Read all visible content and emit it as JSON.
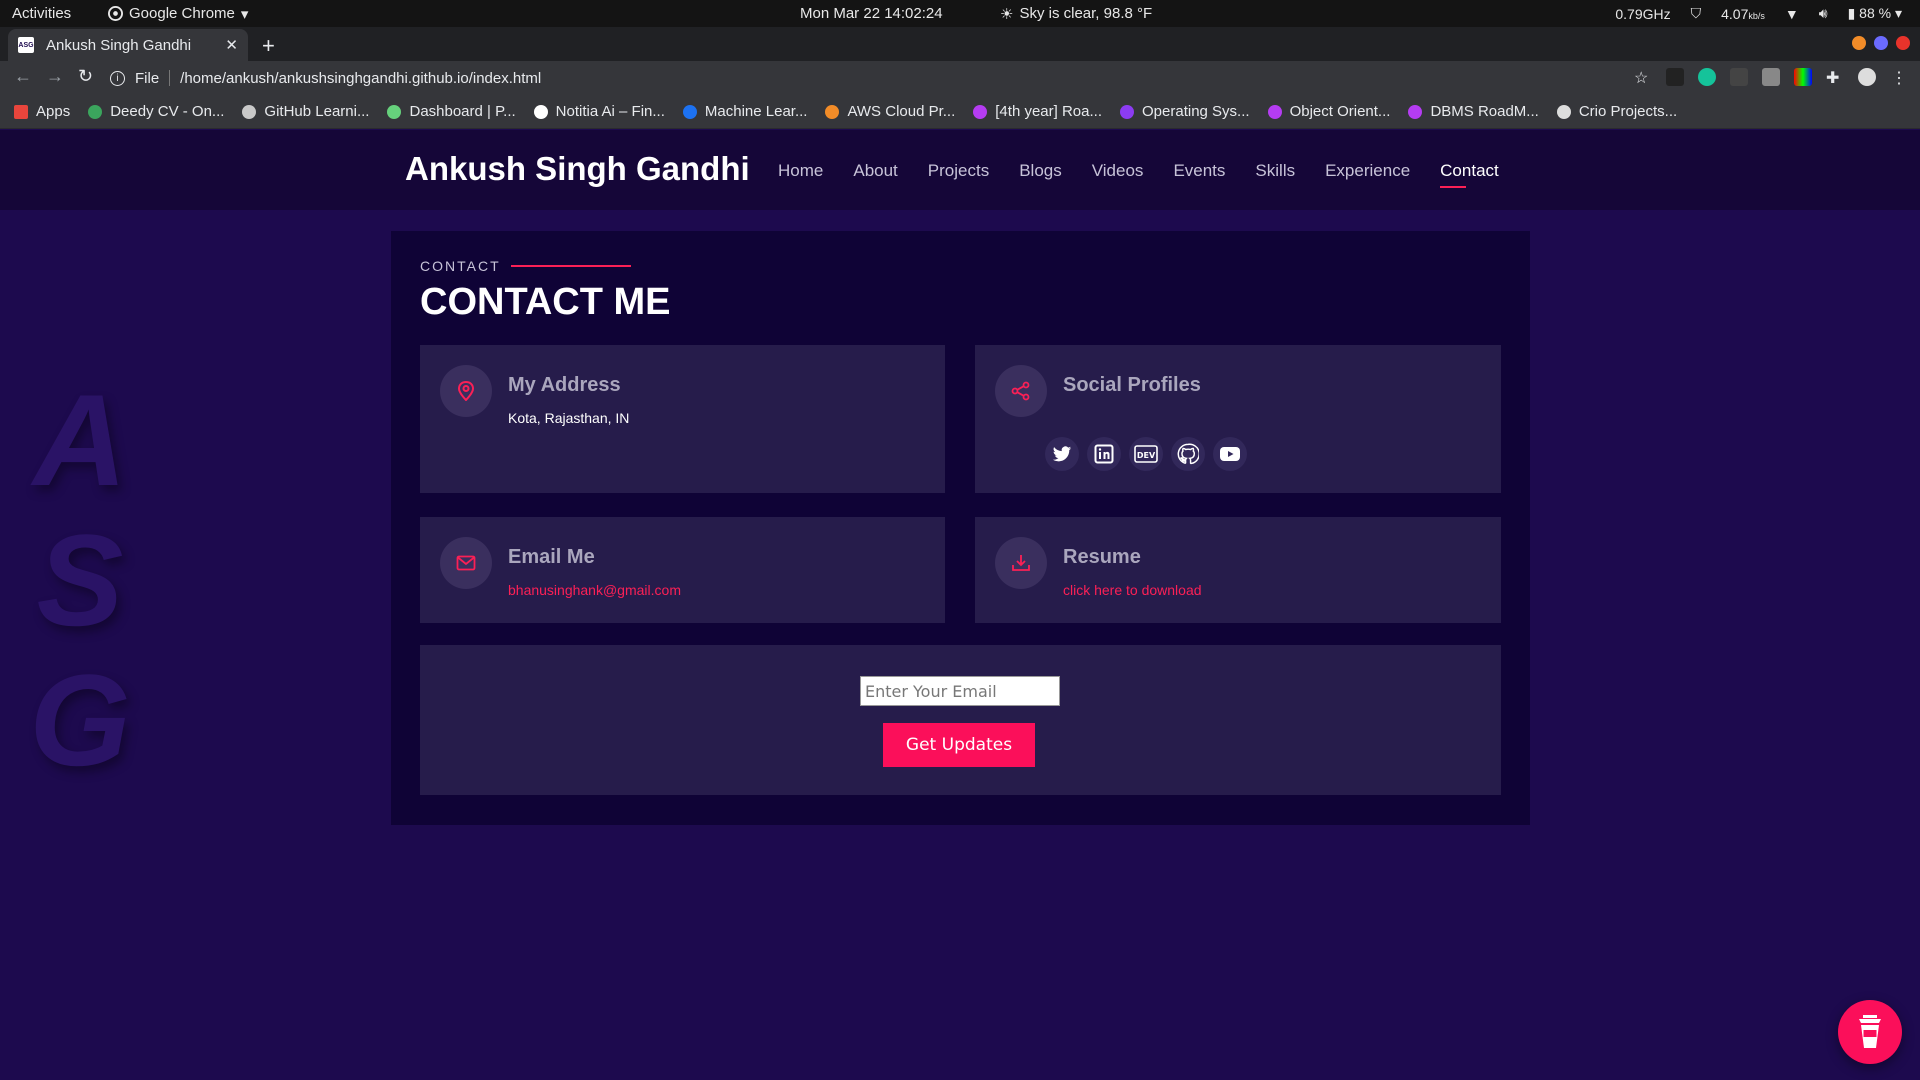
{
  "system_bar": {
    "activities": "Activities",
    "app_name": "Google Chrome",
    "datetime": "Mon Mar 22  14:02:24",
    "weather": "Sky is clear, 98.8 °F",
    "cpu": "0.79GHz",
    "net": "4.07",
    "net_unit": "kb/s",
    "battery": "88 %"
  },
  "browser": {
    "tab_title": "Ankush Singh Gandhi",
    "tab_favicon_text": "ASG",
    "url_scheme": "File",
    "url": "/home/ankush/ankushsinghgandhi.github.io/index.html",
    "bookmarks": [
      {
        "label": "Apps",
        "color": "#e8453c"
      },
      {
        "label": "Deedy CV - On...",
        "color": "#3ba55d"
      },
      {
        "label": "GitHub Learni...",
        "color": "#c9c9c9"
      },
      {
        "label": "Dashboard | P...",
        "color": "#66d17c"
      },
      {
        "label": "Notitia Ai – Fin...",
        "color": "#ffffff"
      },
      {
        "label": "Machine Lear...",
        "color": "#1d72f2"
      },
      {
        "label": "AWS Cloud Pr...",
        "color": "#f28c28"
      },
      {
        "label": "[4th year] Roa...",
        "color": "#b53cf2"
      },
      {
        "label": "Operating Sys...",
        "color": "#8c3cf2"
      },
      {
        "label": "Object Orient...",
        "color": "#b53cf2"
      },
      {
        "label": "DBMS RoadM...",
        "color": "#b53cf2"
      },
      {
        "label": "Crio Projects...",
        "color": "#dddddd"
      }
    ]
  },
  "site": {
    "brand": "Ankush Singh Gandhi",
    "menu": [
      {
        "label": "Home",
        "active": false
      },
      {
        "label": "About",
        "active": false
      },
      {
        "label": "Projects",
        "active": false
      },
      {
        "label": "Blogs",
        "active": false
      },
      {
        "label": "Videos",
        "active": false
      },
      {
        "label": "Events",
        "active": false
      },
      {
        "label": "Skills",
        "active": false
      },
      {
        "label": "Experience",
        "active": false
      },
      {
        "label": "Contact",
        "active": true
      }
    ],
    "watermark": [
      "A",
      "S",
      "G"
    ]
  },
  "contact": {
    "label": "CONTACT",
    "title": "CONTACT ME",
    "address": {
      "title": "My Address",
      "text": "Kota, Rajasthan, IN"
    },
    "social": {
      "title": "Social Profiles",
      "icons": [
        "twitter-icon",
        "linkedin-icon",
        "dev-icon",
        "github-icon",
        "youtube-icon"
      ]
    },
    "email": {
      "title": "Email Me",
      "link": "bhanusinghank@gmail.com"
    },
    "resume": {
      "title": "Resume",
      "link": "click here to download"
    },
    "subscribe": {
      "placeholder": "Enter Your Email",
      "button": "Get Updates"
    }
  },
  "colors": {
    "accent": "#fb2056",
    "page_bg": "#1d0a4e",
    "card_bg": "#0f0336",
    "box_bg": "#261c4b"
  }
}
